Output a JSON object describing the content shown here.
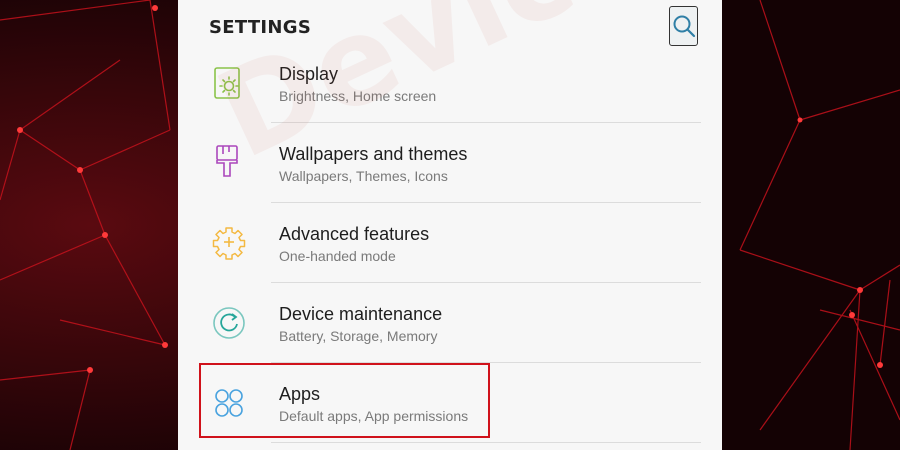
{
  "header": {
    "title": "SETTINGS"
  },
  "items": [
    {
      "title": "Display",
      "subtitle": "Brightness, Home screen",
      "icon": "display-brightness-icon",
      "icon_color": "#8bc34a"
    },
    {
      "title": "Wallpapers and themes",
      "subtitle": "Wallpapers, Themes, Icons",
      "icon": "paint-brush-icon",
      "icon_color": "#ab47bc"
    },
    {
      "title": "Advanced features",
      "subtitle": "One-handed mode",
      "icon": "puzzle-gear-icon",
      "icon_color": "#f4b942"
    },
    {
      "title": "Device maintenance",
      "subtitle": "Battery, Storage, Memory",
      "icon": "refresh-circle-icon",
      "icon_color": "#26a69a"
    },
    {
      "title": "Apps",
      "subtitle": "Default apps, App permissions",
      "icon": "apps-grid-icon",
      "icon_color": "#4aa3df"
    }
  ],
  "watermark": "DeviceTricks",
  "colors": {
    "background": "#1a0306",
    "accent_red": "#d0121b",
    "panel": "#f7f7f7"
  }
}
